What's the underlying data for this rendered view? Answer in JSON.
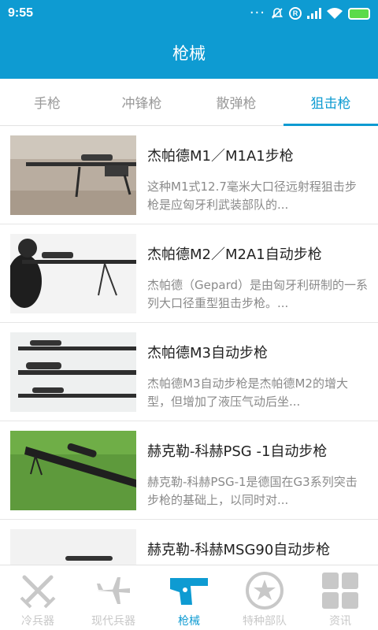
{
  "status": {
    "time": "9:55"
  },
  "appbar": {
    "title": "枪械"
  },
  "tabs": [
    {
      "label": "手枪"
    },
    {
      "label": "冲锋枪"
    },
    {
      "label": "散弹枪"
    },
    {
      "label": "狙击枪"
    }
  ],
  "items": [
    {
      "title": "杰帕德M1／M1A1步枪",
      "desc": "这种M1式12.7毫米大口径远射程狙击步枪是应匈牙利武装部队的..."
    },
    {
      "title": "杰帕德M2／M2A1自动步枪",
      "desc": "杰帕德（Gepard）是由匈牙利研制的一系列大口径重型狙击步枪。..."
    },
    {
      "title": "杰帕德M3自动步枪",
      "desc": "杰帕德M3自动步枪是杰帕德M2的增大型，但增加了液压气动后坐..."
    },
    {
      "title": "赫克勒-科赫PSG -1自动步枪",
      "desc": "赫克勒-科赫PSG-1是德国在G3系列突击步枪的基础上，以同时对..."
    },
    {
      "title": "赫克勒-科赫MSG90自动步枪",
      "desc": ""
    }
  ],
  "nav": [
    {
      "label": "冷兵器",
      "icon": "crossed-swords-icon"
    },
    {
      "label": "现代兵器",
      "icon": "airplane-icon"
    },
    {
      "label": "枪械",
      "icon": "pistol-icon"
    },
    {
      "label": "特种部队",
      "icon": "special-forces-badge-icon"
    },
    {
      "label": "资讯",
      "icon": "grid-icon"
    }
  ],
  "colors": {
    "primary": "#0e9bd2",
    "inactive": "#c8c8c8"
  }
}
